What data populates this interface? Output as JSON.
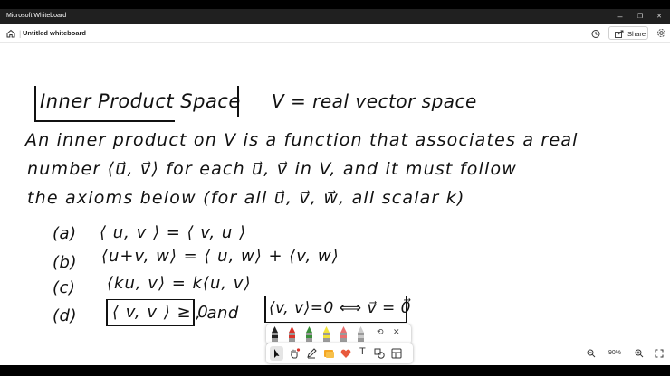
{
  "window": {
    "title": "Microsoft Whiteboard",
    "minimize": "–",
    "maximize": "❐",
    "close": "✕"
  },
  "appbar": {
    "doc_title": "Untitled whiteboard",
    "share_label": "Share"
  },
  "whiteboard": {
    "heading": "Inner Product Space",
    "definition": "V = real vector space",
    "line1": "An inner product on V is a function that associates a real",
    "line2": "number ⟨u⃗, v⃗⟩ for each u⃗, v⃗ in V, and it must follow",
    "line3": "the axioms below (for all u⃗, v⃗, w⃗, all scalar k)",
    "axioms": [
      {
        "label": "(a)",
        "text": "⟨ u, v ⟩ = ⟨ v, u ⟩"
      },
      {
        "label": "(b)",
        "text": "⟨u+v, w⟩ = ⟨ u, w⟩ + ⟨v, w⟩"
      },
      {
        "label": "(c)",
        "text": "⟨ku, v⟩ = k⟨u, v⟩"
      },
      {
        "label": "(d)",
        "text": "⟨ v, v ⟩ ≥ 0",
        "and": ", and",
        "extra": "⟨v, v⟩=0 ⟺ v⃗ = 0⃗"
      }
    ]
  },
  "pen_tray": {
    "pens": [
      {
        "name": "black-pen",
        "color": "#222222"
      },
      {
        "name": "red-pen",
        "color": "#d9342b"
      },
      {
        "name": "green-pen",
        "color": "#3a8f3a"
      },
      {
        "name": "yellow-highlighter",
        "color": "#f2e23a"
      },
      {
        "name": "pink-highlighter",
        "color": "#e86f6f"
      },
      {
        "name": "eraser",
        "color": "#cccccc"
      }
    ]
  },
  "zoom": {
    "level": "90%",
    "minus": "−",
    "plus": "+"
  }
}
